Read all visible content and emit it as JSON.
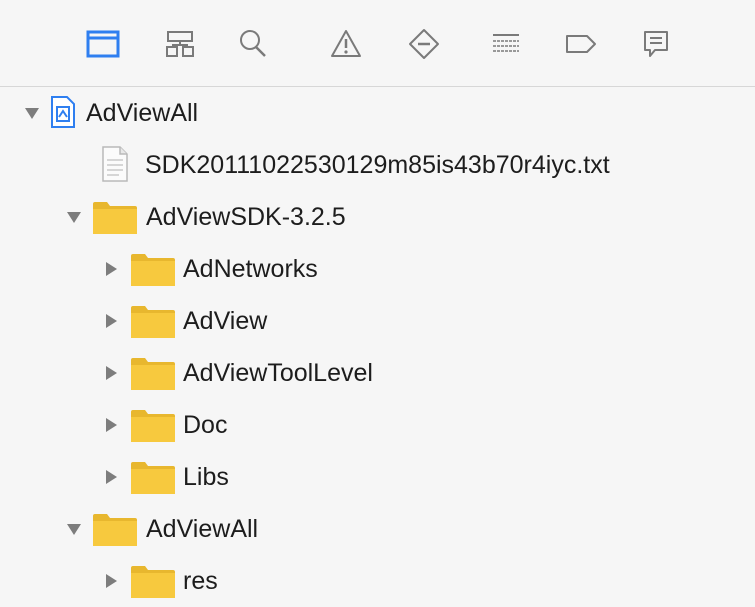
{
  "navigator": {
    "tabs": [
      {
        "name": "project-navigator",
        "icon": "folder-icon",
        "selected": true
      },
      {
        "name": "symbol-navigator",
        "icon": "hierarchy-icon",
        "selected": false
      },
      {
        "name": "find-navigator",
        "icon": "search-icon",
        "selected": false
      },
      {
        "name": "issue-navigator",
        "icon": "warning-icon",
        "selected": false
      },
      {
        "name": "test-navigator",
        "icon": "test-diamond-icon",
        "selected": false
      },
      {
        "name": "debug-navigator",
        "icon": "debug-list-icon",
        "selected": false
      },
      {
        "name": "breakpoint-navigator",
        "icon": "breakpoint-tag-icon",
        "selected": false
      },
      {
        "name": "report-navigator",
        "icon": "report-bubble-icon",
        "selected": false
      }
    ],
    "accent_color": "#2f7ff0",
    "icon_color": "#7a7a7a"
  },
  "tree": {
    "items": [
      {
        "label": "AdViewAll",
        "kind": "project",
        "icon": "project-file-icon",
        "expanded": true
      },
      {
        "label": "SDK20111022530129m85is43b70r4iyc.txt",
        "kind": "file",
        "icon": "text-file-icon"
      },
      {
        "label": "AdViewSDK-3.2.5",
        "kind": "group",
        "icon": "folder-icon",
        "expanded": true
      },
      {
        "label": "AdNetworks",
        "kind": "group",
        "icon": "folder-icon",
        "expanded": false
      },
      {
        "label": "AdView",
        "kind": "group",
        "icon": "folder-icon",
        "expanded": false
      },
      {
        "label": "AdViewToolLevel",
        "kind": "group",
        "icon": "folder-icon",
        "expanded": false
      },
      {
        "label": "Doc",
        "kind": "group",
        "icon": "folder-icon",
        "expanded": false
      },
      {
        "label": "Libs",
        "kind": "group",
        "icon": "folder-icon",
        "expanded": false
      },
      {
        "label": "AdViewAll",
        "kind": "group",
        "icon": "folder-icon",
        "expanded": true
      },
      {
        "label": "res",
        "kind": "group",
        "icon": "folder-icon",
        "expanded": false
      }
    ],
    "folder_color": "#f7c93e"
  }
}
